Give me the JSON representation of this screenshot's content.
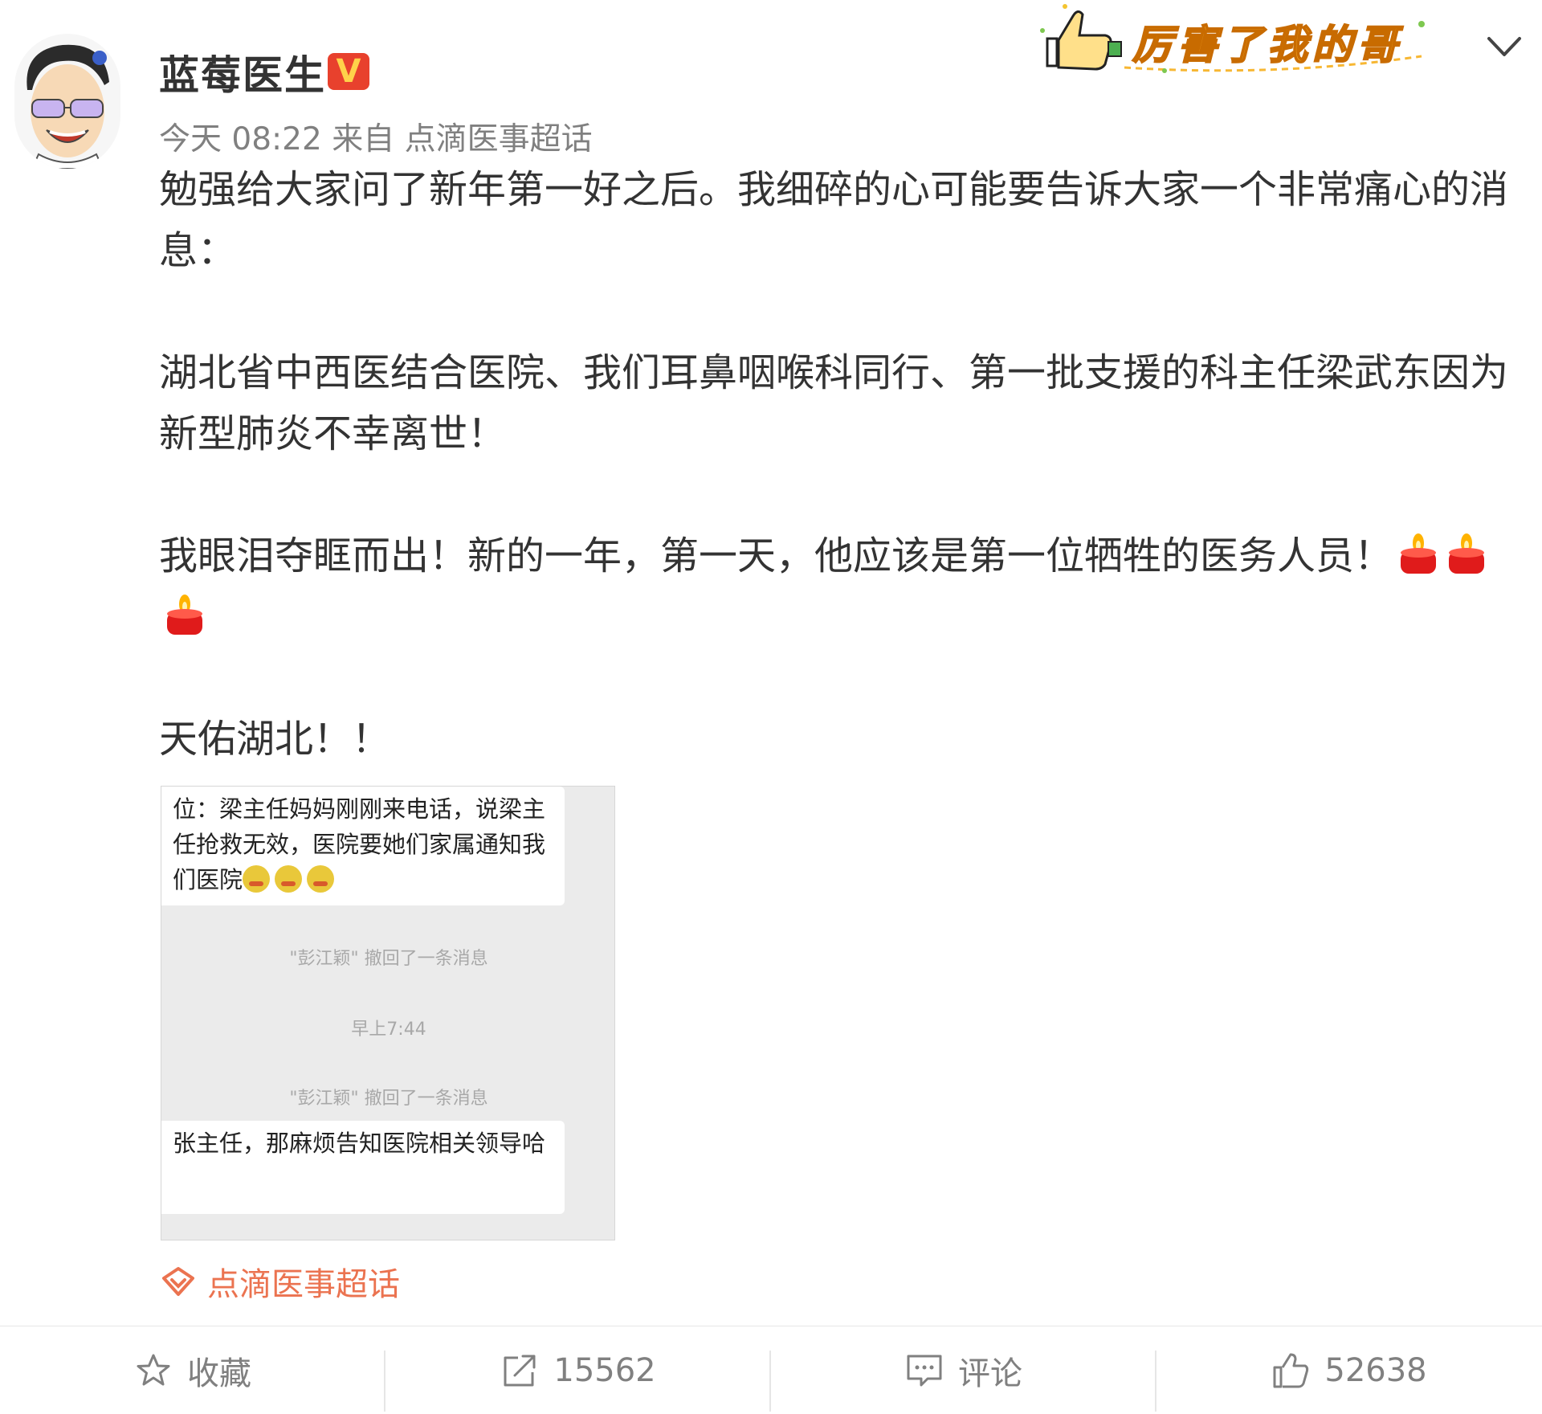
{
  "user": {
    "name": "蓝莓医生",
    "verified_badge": "V",
    "verified_color": "#e8412d"
  },
  "meta": {
    "time": "今天 08:22",
    "from_label": "来自",
    "source": "点滴医事超话"
  },
  "sticker": {
    "text": "厉害了我的哥",
    "icon": "thumbs-up-icon"
  },
  "post": {
    "paragraphs": [
      "勉强给大家问了新年第一好之后。我细碎的心可能要告诉大家一个非常痛心的消息：",
      "湖北省中西医结合医院、我们耳鼻咽喉科同行、第一批支援的科主任梁武东因为新型肺炎不幸离世！",
      "我眼泪夺眶而出！新的一年，第一天，他应该是第一位牺牲的医务人员！",
      "天佑湖北！！"
    ],
    "candle_emoji_count": 3
  },
  "chat_image": {
    "message1": "位：梁主任妈妈刚刚来电话，说梁主任抢救无效，医院要她们家属通知我们医院",
    "system1": "\"彭江颖\" 撤回了一条消息",
    "time": "早上7:44",
    "system2": "\"彭江颖\" 撤回了一条消息",
    "message2": "张主任，那麻烦告知医院相关领导哈"
  },
  "topic": {
    "label": "点滴医事超话",
    "color": "#eb7350"
  },
  "actions": {
    "favorite_label": "收藏",
    "repost_count": "15562",
    "comment_label": "评论",
    "like_count": "52638"
  }
}
